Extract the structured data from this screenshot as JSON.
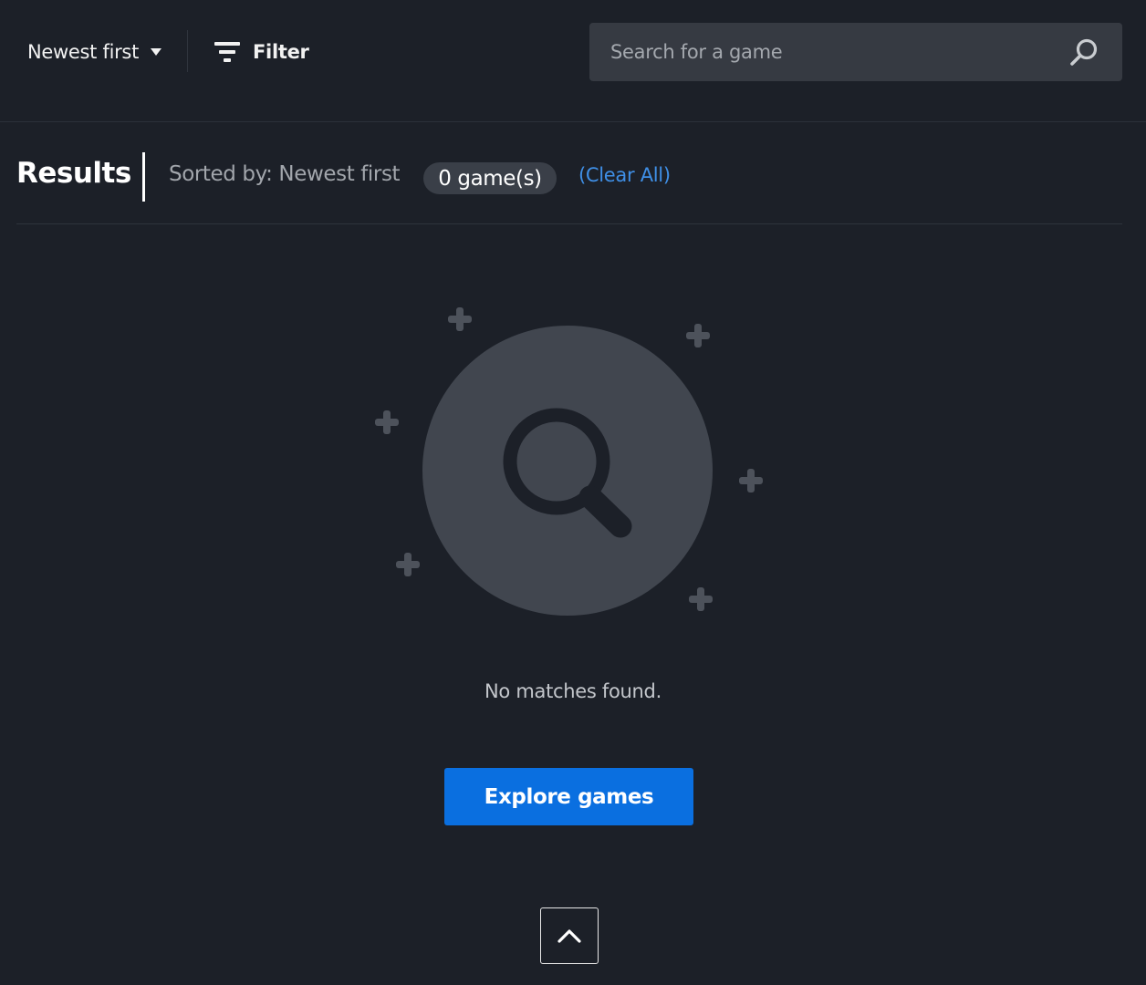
{
  "toolbar": {
    "sort_label": "Newest first",
    "sort_caret_icon": "caret-down-icon",
    "filter_label": "Filter",
    "filter_icon": "filter-funnel-icon",
    "search_placeholder": "Search for a game",
    "search_icon": "search-icon"
  },
  "results": {
    "title": "Results",
    "sorted_by": "Sorted by: Newest first",
    "count": "0 game(s)",
    "clear_all": "(Clear All)"
  },
  "empty_state": {
    "illustration_icon": "magnifier-illustration-icon",
    "message": "No matches found.",
    "cta_label": "Explore games"
  },
  "scroll_top_icon": "chevron-up-icon",
  "colors": {
    "background": "#1c2028",
    "search_bg": "#363a42",
    "accent_blue": "#0a6fe0",
    "link_blue": "#3f8fe6",
    "illustration_circle": "#41464f",
    "illustration_plus": "#4d525b"
  }
}
